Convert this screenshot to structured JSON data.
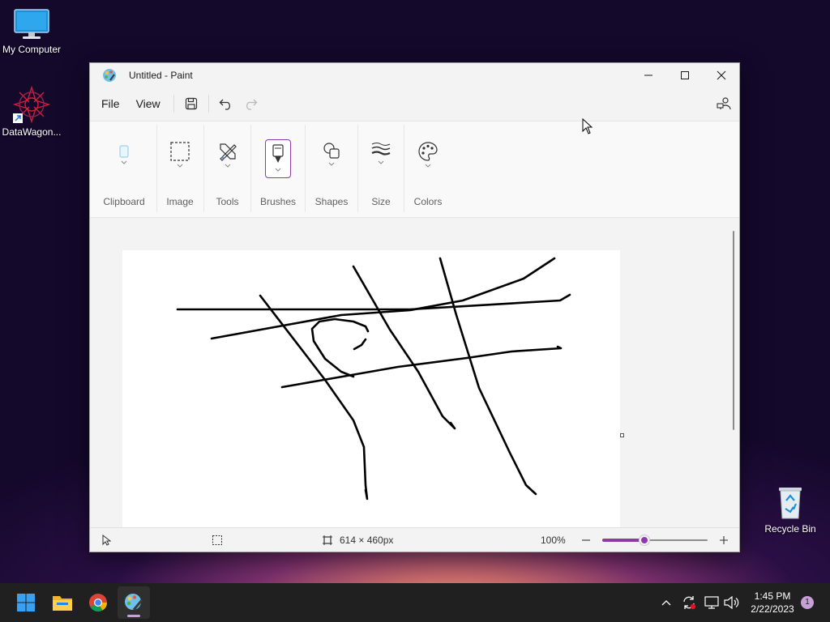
{
  "desktop": {
    "icons": [
      {
        "label": "My Computer"
      },
      {
        "label": "DataWagon..."
      },
      {
        "label": "Recycle Bin"
      }
    ]
  },
  "window": {
    "title": "Untitled - Paint",
    "menu": {
      "file": "File",
      "view": "View"
    },
    "ribbon": {
      "groups": [
        {
          "label": "Clipboard",
          "icon": "clipboard-icon"
        },
        {
          "label": "Image",
          "icon": "select-icon"
        },
        {
          "label": "Tools",
          "icon": "tools-icon"
        },
        {
          "label": "Brushes",
          "icon": "brush-icon"
        },
        {
          "label": "Shapes",
          "icon": "shapes-icon"
        },
        {
          "label": "Size",
          "icon": "size-icon"
        },
        {
          "label": "Colors",
          "icon": "palette-icon"
        }
      ]
    },
    "status": {
      "canvas_size": "614 × 460px",
      "zoom": "100%",
      "zoom_level_fraction": 0.4
    },
    "accent_color": "#8e3aa8"
  },
  "taskbar": {
    "apps": [
      "start-icon",
      "file-explorer-icon",
      "chrome-icon",
      "paint-icon"
    ],
    "clock": {
      "time": "1:45 PM",
      "date": "2/22/2023"
    },
    "notifications": "1"
  }
}
